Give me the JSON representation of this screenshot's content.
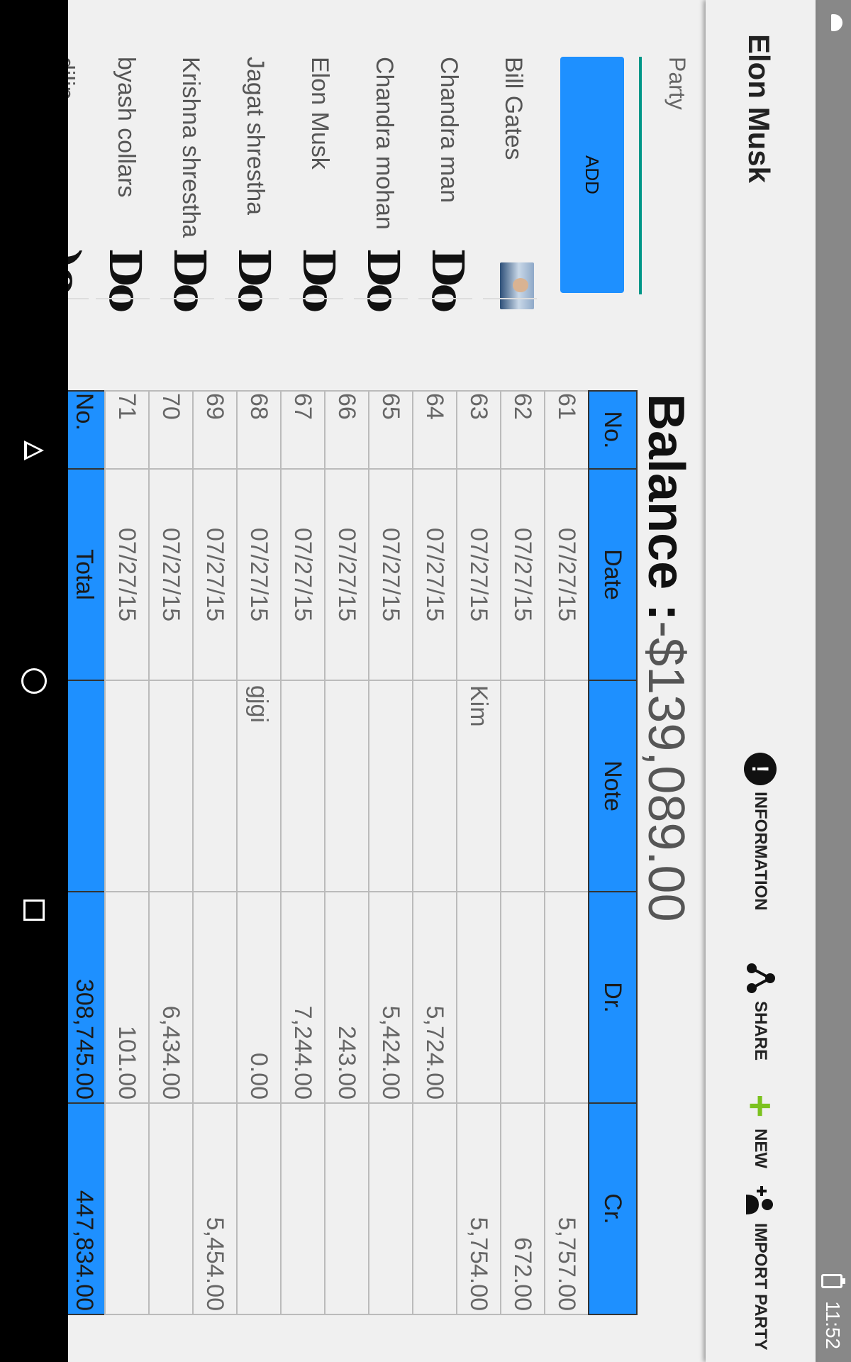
{
  "status_bar": {
    "time": "11:52"
  },
  "action_bar": {
    "title": "Elon Musk",
    "actions": [
      {
        "label": "INFORMATION",
        "icon": "info-icon"
      },
      {
        "label": "SHARE",
        "icon": "share-icon"
      },
      {
        "label": "NEW",
        "icon": "plus-icon"
      },
      {
        "label": "IMPORT PARTY",
        "icon": "add-person-icon"
      }
    ]
  },
  "left_panel": {
    "party_label": "Party",
    "add_button": "ADD",
    "parties": [
      {
        "name": "Bill Gates",
        "icon": "avatar-photo"
      },
      {
        "name": "Chandra man",
        "icon": "do-glyph"
      },
      {
        "name": "Chandra mohan",
        "icon": "do-glyph"
      },
      {
        "name": "Elon Musk",
        "icon": "do-glyph"
      },
      {
        "name": "Jagat shrestha",
        "icon": "do-glyph"
      },
      {
        "name": "Krishna shrestha",
        "icon": "do-glyph"
      },
      {
        "name": "byash collars",
        "icon": "do-glyph"
      },
      {
        "name": "dilip",
        "icon": "do-glyph"
      }
    ],
    "do_text": "Do",
    "do_partial": ")o"
  },
  "balance": {
    "label": "Balance :",
    "value": "-$139,089.00"
  },
  "ledger": {
    "headers": {
      "no": "No.",
      "date": "Date",
      "note": "Note",
      "dr": "Dr.",
      "cr": "Cr."
    },
    "rows": [
      {
        "no": "61",
        "date": "07/27/15",
        "note": "",
        "dr": "",
        "cr": "5,757.00"
      },
      {
        "no": "62",
        "date": "07/27/15",
        "note": "",
        "dr": "",
        "cr": "672.00"
      },
      {
        "no": "63",
        "date": "07/27/15",
        "note": "Kim",
        "dr": "",
        "cr": "5,754.00"
      },
      {
        "no": "64",
        "date": "07/27/15",
        "note": "",
        "dr": "5,724.00",
        "cr": ""
      },
      {
        "no": "65",
        "date": "07/27/15",
        "note": "",
        "dr": "5,424.00",
        "cr": ""
      },
      {
        "no": "66",
        "date": "07/27/15",
        "note": "",
        "dr": "243.00",
        "cr": ""
      },
      {
        "no": "67",
        "date": "07/27/15",
        "note": "",
        "dr": "7,244.00",
        "cr": ""
      },
      {
        "no": "68",
        "date": "07/27/15",
        "note": "gjgi",
        "dr": "0.00",
        "cr": ""
      },
      {
        "no": "69",
        "date": "07/27/15",
        "note": "",
        "dr": "",
        "cr": "5,454.00"
      },
      {
        "no": "70",
        "date": "07/27/15",
        "note": "",
        "dr": "6,434.00",
        "cr": ""
      },
      {
        "no": "71",
        "date": "07/27/15",
        "note": "",
        "dr": "101.00",
        "cr": ""
      }
    ],
    "footer": {
      "no": "No.",
      "date": "Total",
      "note": "",
      "dr": "308,745.00",
      "cr": "447,834.00"
    }
  },
  "nav_bar": {
    "buttons": [
      "back",
      "home",
      "recents"
    ]
  }
}
